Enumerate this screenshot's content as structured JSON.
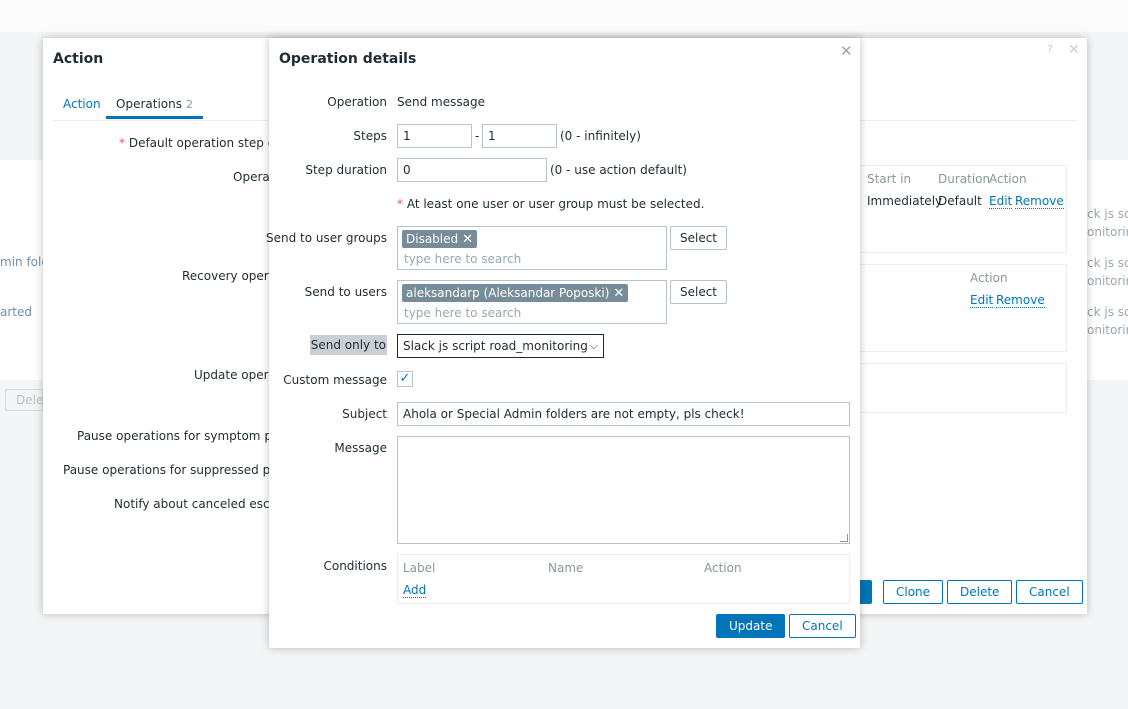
{
  "background": {
    "rows": [
      "ck js scr",
      "onitoring",
      "min fold",
      "ck js scr",
      "onitoring",
      "arted",
      "ck js scr",
      "onitoring",
      "Dele"
    ]
  },
  "action_dialog": {
    "title": "Action",
    "help_icon": "?",
    "close_icon": "✕",
    "tabs": [
      {
        "label": "Action"
      },
      {
        "label": "Operations",
        "count": "2"
      }
    ],
    "labels": {
      "default_step_duration": "Default operation step dura",
      "operations": "Operat",
      "recovery_operations": "Recovery opera",
      "update_operations": "Update operat",
      "pause_symptom": "Pause operations for symptom probl",
      "pause_suppressed": "Pause operations for suppressed probl",
      "notify_canceled": "Notify about canceled escalat"
    },
    "operations_table": {
      "headers": [
        "Start in",
        "Duration",
        "Action"
      ],
      "row": {
        "start_in": "Immediately",
        "duration": "Default",
        "edit": "Edit",
        "remove": "Remove"
      }
    },
    "recovery_table": {
      "header": "Action",
      "edit": "Edit",
      "remove": "Remove"
    },
    "buttons": {
      "clone": "Clone",
      "delete": "Delete",
      "cancel": "Cancel"
    }
  },
  "operation_dialog": {
    "title": "Operation details",
    "close_icon": "✕",
    "operation": {
      "label": "Operation",
      "value": "Send message"
    },
    "steps": {
      "label": "Steps",
      "from": "1",
      "separator": "-",
      "to": "1",
      "hint": "(0 - infinitely)"
    },
    "step_duration": {
      "label": "Step duration",
      "value": "0",
      "hint": "(0 - use action default)"
    },
    "required_note": "At least one user or user group must be selected.",
    "send_to_user_groups": {
      "label": "Send to user groups",
      "chips": [
        "Disabled"
      ],
      "placeholder": "type here to search",
      "select_button": "Select"
    },
    "send_to_users": {
      "label": "Send to users",
      "chips": [
        "aleksandarp (Aleksandar Poposki)"
      ],
      "placeholder": "type here to search",
      "select_button": "Select"
    },
    "send_only_to": {
      "label": "Send only to",
      "value": "Slack js script road_monitoring"
    },
    "custom_message": {
      "label": "Custom message",
      "checked": true
    },
    "subject": {
      "label": "Subject",
      "value": "Ahola or Special Admin folders are not empty, pls check!"
    },
    "message": {
      "label": "Message",
      "value": ""
    },
    "conditions": {
      "label": "Conditions",
      "headers": [
        "Label",
        "Name",
        "Action"
      ],
      "add_link": "Add"
    },
    "buttons": {
      "update": "Update",
      "cancel": "Cancel"
    }
  },
  "colors": {
    "accent": "#0275b8",
    "required": "#e45959",
    "chip": "#768d99",
    "muted_text": "#8a969c"
  }
}
